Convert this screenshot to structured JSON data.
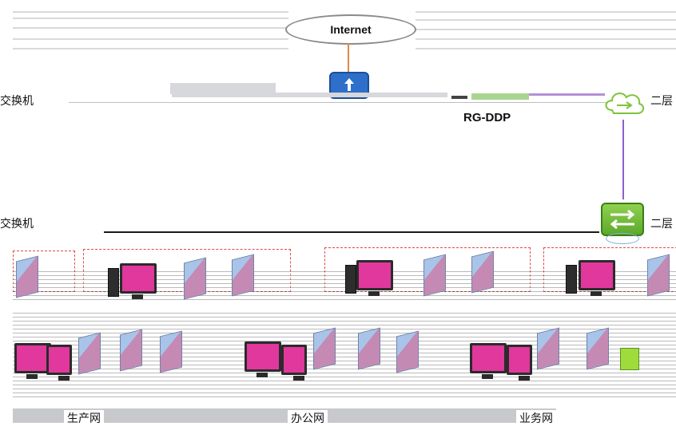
{
  "internet_label": "Internet",
  "ddp_label": "RG-DDP",
  "left_core_label": "交换机",
  "left_agg_label": "交换机",
  "right_top_label": "二层",
  "right_mid_label": "二层",
  "zone_labels": [
    "生产网",
    "办公网",
    "业务网"
  ],
  "colors": {
    "router": "#2f6fc9",
    "switch": "#7cc43a",
    "uplink": "#e2884a",
    "ddp_link": "#8c5fd1",
    "zone_border": "#e04a4a",
    "pc_screen": "#e0389c"
  },
  "icons": [
    "cloud-icon",
    "router-icon",
    "layer3-switch-icon",
    "server-icon",
    "pc-monitor-icon"
  ]
}
